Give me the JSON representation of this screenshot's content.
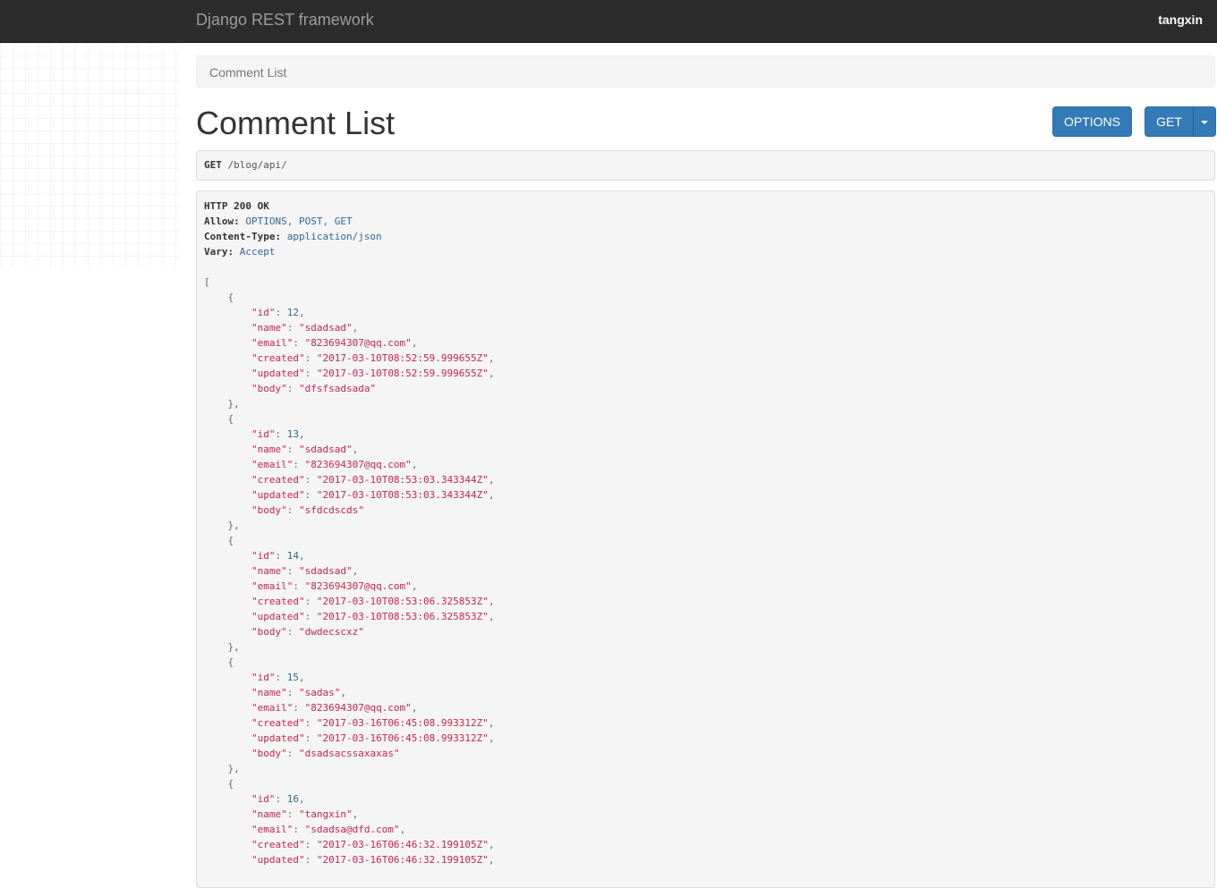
{
  "navbar": {
    "brand": "Django REST framework",
    "user": "tangxin"
  },
  "breadcrumb": {
    "item": "Comment List"
  },
  "page": {
    "title": "Comment List"
  },
  "buttons": {
    "options": "OPTIONS",
    "get": "GET"
  },
  "request": {
    "method": "GET",
    "url": "/blog/api/"
  },
  "response": {
    "status": "HTTP 200 OK",
    "headers": [
      {
        "key": "Allow:",
        "value": "OPTIONS, POST, GET"
      },
      {
        "key": "Content-Type:",
        "value": "application/json"
      },
      {
        "key": "Vary:",
        "value": "Accept"
      }
    ],
    "comments": [
      {
        "id": "12",
        "name": "\"sdadsad\"",
        "email": "\"823694307@qq.com\"",
        "created": "\"2017-03-10T08:52:59.999655Z\"",
        "updated": "\"2017-03-10T08:52:59.999655Z\"",
        "body": "\"dfsfsadsada\""
      },
      {
        "id": "13",
        "name": "\"sdadsad\"",
        "email": "\"823694307@qq.com\"",
        "created": "\"2017-03-10T08:53:03.343344Z\"",
        "updated": "\"2017-03-10T08:53:03.343344Z\"",
        "body": "\"sfdcdscds\""
      },
      {
        "id": "14",
        "name": "\"sdadsad\"",
        "email": "\"823694307@qq.com\"",
        "created": "\"2017-03-10T08:53:06.325853Z\"",
        "updated": "\"2017-03-10T08:53:06.325853Z\"",
        "body": "\"dwdecscxz\""
      },
      {
        "id": "15",
        "name": "\"sadas\"",
        "email": "\"823694307@qq.com\"",
        "created": "\"2017-03-16T06:45:08.993312Z\"",
        "updated": "\"2017-03-16T06:45:08.993312Z\"",
        "body": "\"dsadsacssaxaxas\""
      },
      {
        "id": "16",
        "name": "\"tangxin\"",
        "email": "\"sdadsa@dfd.com\"",
        "created": "\"2017-03-16T06:46:32.199105Z\"",
        "updated": "\"2017-03-16T06:46:32.199105Z\""
      }
    ]
  }
}
